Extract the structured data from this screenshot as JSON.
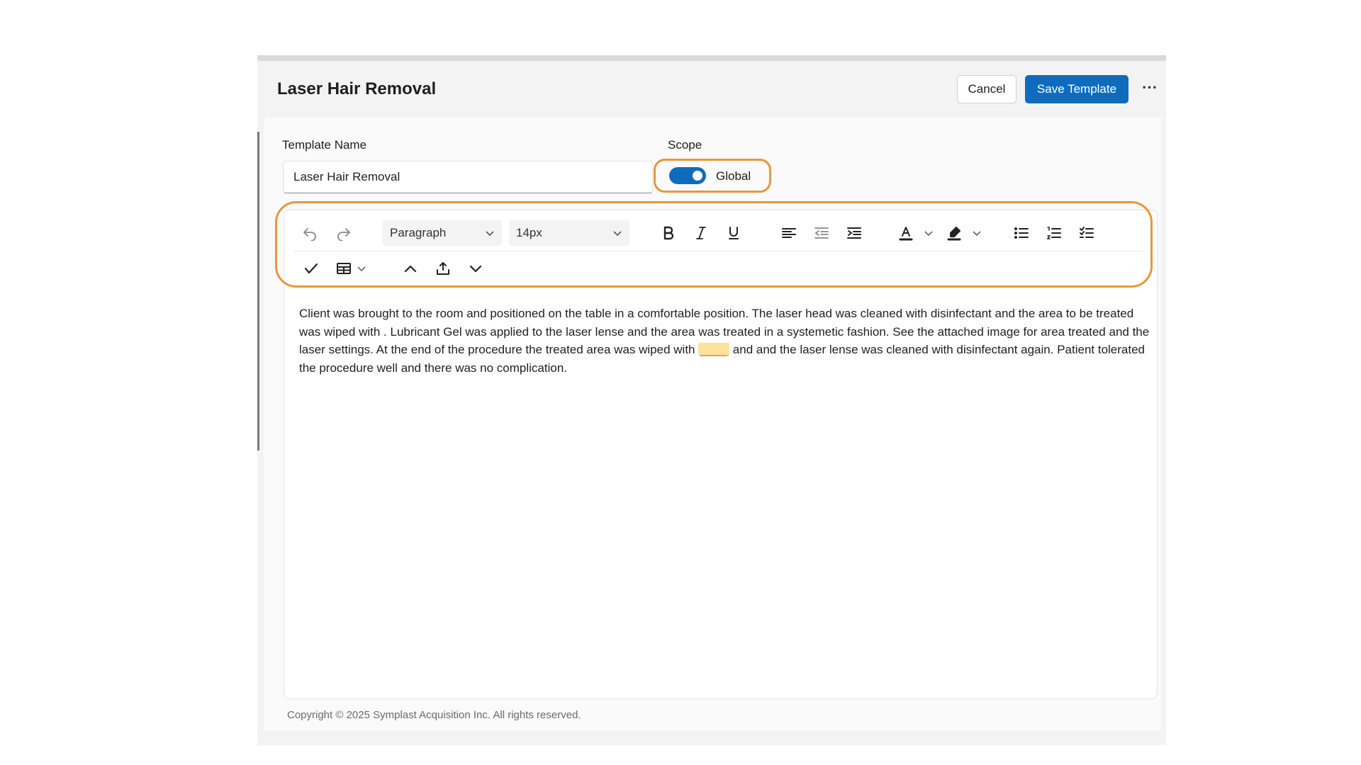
{
  "header": {
    "title": "Laser Hair Removal",
    "cancel_label": "Cancel",
    "save_label": "Save Template",
    "more_label": "⋯"
  },
  "form": {
    "template_name_label": "Template Name",
    "template_name_value": "Laser Hair Removal",
    "scope_label": "Scope",
    "scope_value": "Global",
    "scope_enabled": true
  },
  "toolbar": {
    "block_format": "Paragraph",
    "font_size": "14px",
    "icons": [
      "undo-icon",
      "redo-icon",
      "bold-icon",
      "italic-icon",
      "underline-icon",
      "align-left-icon",
      "outdent-icon",
      "indent-icon",
      "text-color-icon",
      "highlight-icon",
      "bullet-list-icon",
      "numbered-list-icon",
      "checklist-icon",
      "spellcheck-icon",
      "table-icon",
      "move-up-icon",
      "insert-icon",
      "move-down-icon"
    ]
  },
  "editor": {
    "text_part1": "Client was brought to the room and positioned on the table in a comfortable position. The laser head was cleaned with disinfectant and the area to be treated was wiped with .    Lubricant Gel was applied to the laser lense and the area was treated in a systemetic fashion. See the attached image for area treated and the laser settings. At the end of the procedure the treated area was wiped with ",
    "placeholder": "____",
    "text_part2": " and and the laser lense was cleaned with disinfectant again. Patient tolerated the procedure well and there was no complication."
  },
  "footer": {
    "copyright": "Copyright © 2025 Symplast Acquisition Inc. All rights reserved."
  },
  "colors": {
    "primary": "#0f6cbd",
    "highlight_ring": "#e8973d",
    "placeholder_bg": "#fde39a"
  }
}
